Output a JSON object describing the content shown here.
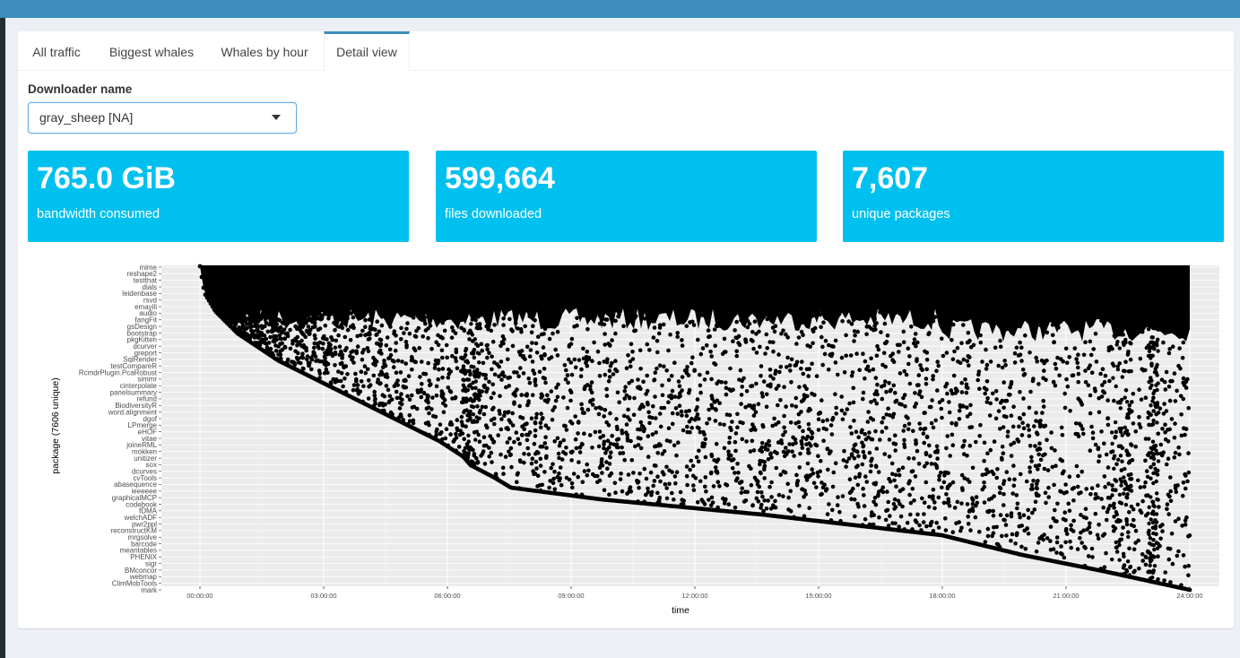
{
  "tabs": [
    {
      "label": "All traffic"
    },
    {
      "label": "Biggest whales"
    },
    {
      "label": "Whales by hour"
    },
    {
      "label": "Detail view"
    }
  ],
  "active_tab": "Detail view",
  "downloader": {
    "label": "Downloader name",
    "selected": "gray_sheep [NA]"
  },
  "value_boxes": [
    {
      "value": "765.0 GiB",
      "subtitle": "bandwidth consumed"
    },
    {
      "value": "599,664",
      "subtitle": "files downloaded"
    },
    {
      "value": "7,607",
      "subtitle": "unique packages"
    }
  ],
  "colors": {
    "accent": "#3c8dbc",
    "value_box": "#00c0ef",
    "panel_bg": "#ebebeb",
    "point": "#000000"
  },
  "chart_data": {
    "type": "scatter",
    "xlabel": "time",
    "ylabel": "package (7606 unique)",
    "x_ticks": [
      "00:00:00",
      "03:00:00",
      "06:00:00",
      "09:00:00",
      "12:00:00",
      "15:00:00",
      "18:00:00",
      "21:00:00",
      "24:00:00"
    ],
    "y_ticks": [
      "mime",
      "reshape2",
      "testthat",
      "dials",
      "leidenbase",
      "rsvd",
      "emayili",
      "audio",
      "fangFit",
      "gsDesign",
      "bootstrap",
      "pkgKitten",
      "dcurver",
      "greport",
      "SqlRender",
      "testCompareR",
      "RcmdrPlugin.PcaRobust",
      "simmr",
      "cinterpolate",
      "panelsummary",
      "refund",
      "BiodiversityR",
      "word.alignment",
      "dgof",
      "LPmerge",
      "eHOF",
      "vitae",
      "joineRML",
      "mokken",
      "unitizer",
      "sox",
      "dcurves",
      "cvTools",
      "abasequence",
      "ieeeeee",
      "graphicalMCP",
      "codebook",
      "fDMA",
      "welchADF",
      "pwr2ppl",
      "reconstructKM",
      "mrgsolve",
      "barcode",
      "meantables",
      "PHENIX",
      "sigr",
      "BMconcor",
      "webmap",
      "ClimMobTools",
      "mark"
    ],
    "x_range_hours": [
      0,
      24
    ],
    "grid": true
  }
}
